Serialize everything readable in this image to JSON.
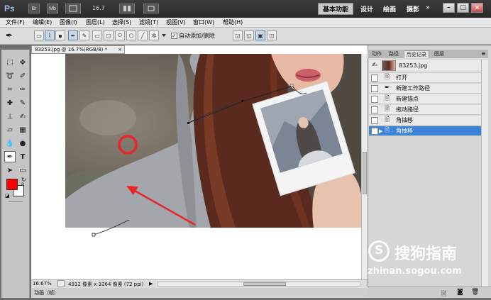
{
  "app": {
    "logo": "Ps",
    "bridge_btn": "Br",
    "minibridge_btn": "Mb",
    "zoom": "16.7",
    "workspace_active": "基本功能",
    "workspaces": [
      "设计",
      "绘画",
      "摄影"
    ],
    "more": "»"
  },
  "window_buttons": {
    "minimize": "–",
    "restore": "□",
    "close": "×"
  },
  "menu": [
    "文件(F)",
    "编辑(E)",
    "图像(I)",
    "图层(L)",
    "选择(S)",
    "滤镜(T)",
    "视图(V)",
    "窗口(W)",
    "帮助(H)"
  ],
  "options": {
    "auto_add_delete_label": "自动添加/删除",
    "auto_add_delete_checked": true
  },
  "document": {
    "tab_title": "83253.jpg @ 16.7%(RGB/8) *",
    "tab_close": "×"
  },
  "status": {
    "zoom_value": "16.67%",
    "doc_info": "4912 像素 x 3264 像素 (72 ppi)",
    "bottom_label": "动画（帧）"
  },
  "panel": {
    "tabs": [
      "动作",
      "路径",
      "历史记录",
      "图层"
    ],
    "active_tab": "历史记录",
    "snapshot_name": "83253.jpg",
    "history": [
      {
        "icon": "document-icon",
        "label": "打开"
      },
      {
        "icon": "pen-icon",
        "label": "新建工作路径"
      },
      {
        "icon": "document-icon",
        "label": "新建锚点"
      },
      {
        "icon": "document-icon",
        "label": "拖动路径"
      },
      {
        "icon": "document-icon",
        "label": "角抽移"
      },
      {
        "icon": "document-icon",
        "label": "角抽移",
        "active": true
      }
    ]
  },
  "watermark": {
    "logo_text": "搜狗指南",
    "url": "zhinan.sogou.com"
  },
  "colors": {
    "foreground": "#ff0000",
    "background": "#ffffff",
    "annotation": "#e8262b",
    "accent": "#3a83d8"
  }
}
